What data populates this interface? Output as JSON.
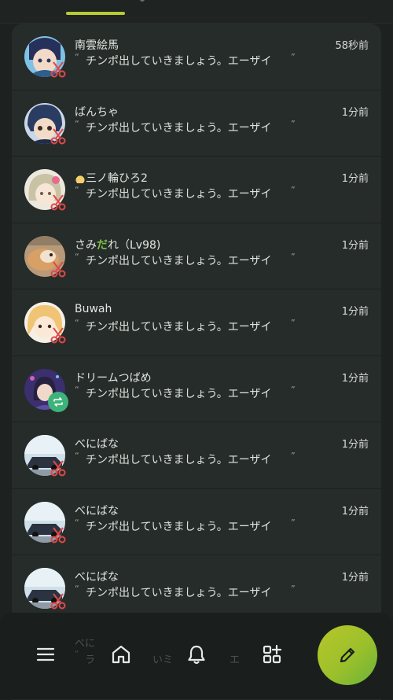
{
  "colors": {
    "accent": "#b9cc2e",
    "renote_badge": "#3db37a",
    "clip_icon": "#e24848",
    "panel_bg": "#262c2a"
  },
  "tabs": {
    "active_indicator": "accent-underline"
  },
  "notifications": [
    {
      "name": "南雲絵馬",
      "time": "58秒前",
      "quote_open": "“",
      "text": "チンポ出していきましょう。エーザイ",
      "quote_close": "”",
      "badge": "clip-icon"
    },
    {
      "name": "ばんちゃ",
      "time": "1分前",
      "quote_open": "“",
      "text": "チンポ出していきましょう。エーザイ",
      "quote_close": "”",
      "badge": "clip-icon"
    },
    {
      "name": "三ノ輪ひろ2",
      "time": "1分前",
      "quote_open": "“",
      "text": "チンポ出していきましょう。エーザイ",
      "quote_close": "”",
      "badge": "clip-icon",
      "name_prefix_icon": "custom-emoji-icon"
    },
    {
      "name_a": "さみ",
      "name_b": "だ",
      "name_c": "れ（Lv98)",
      "time": "1分前",
      "quote_open": "“",
      "text": "チンポ出していきましょう。エーザイ",
      "quote_close": "”",
      "badge": "clip-icon"
    },
    {
      "name": "Buwah",
      "time": "1分前",
      "quote_open": "“",
      "text": "チンポ出していきましょう。エーザイ",
      "quote_close": "”",
      "badge": "clip-icon"
    },
    {
      "name": "ドリームつばめ",
      "time": "1分前",
      "quote_open": "“",
      "text": "チンポ出していきましょう。エーザイ",
      "quote_close": "”",
      "badge": "renote-icon"
    },
    {
      "name": "べにばな",
      "time": "1分前",
      "quote_open": "“",
      "text": "チンポ出していきましょう。エーザイ",
      "quote_close": "”",
      "badge": "clip-icon"
    },
    {
      "name": "べにばな",
      "time": "1分前",
      "quote_open": "“",
      "text": "チンポ出していきましょう。エーザイ",
      "quote_close": "”",
      "badge": "clip-icon"
    },
    {
      "name": "べにばな",
      "time": "1分前",
      "quote_open": "“",
      "text": "チンポ出していきましょう。エーザイ",
      "quote_close": "”",
      "badge": "clip-icon"
    }
  ],
  "partial_item": {
    "name": "べに",
    "quote_open": "“",
    "text_a": "ラ",
    "text_b": "いミ",
    "text_c": "エ"
  },
  "bottom_nav": [
    {
      "icon": "menu-icon"
    },
    {
      "icon": "home-icon"
    },
    {
      "icon": "bell-icon"
    },
    {
      "icon": "widgets-icon"
    }
  ],
  "fab": {
    "icon": "pencil-icon"
  }
}
